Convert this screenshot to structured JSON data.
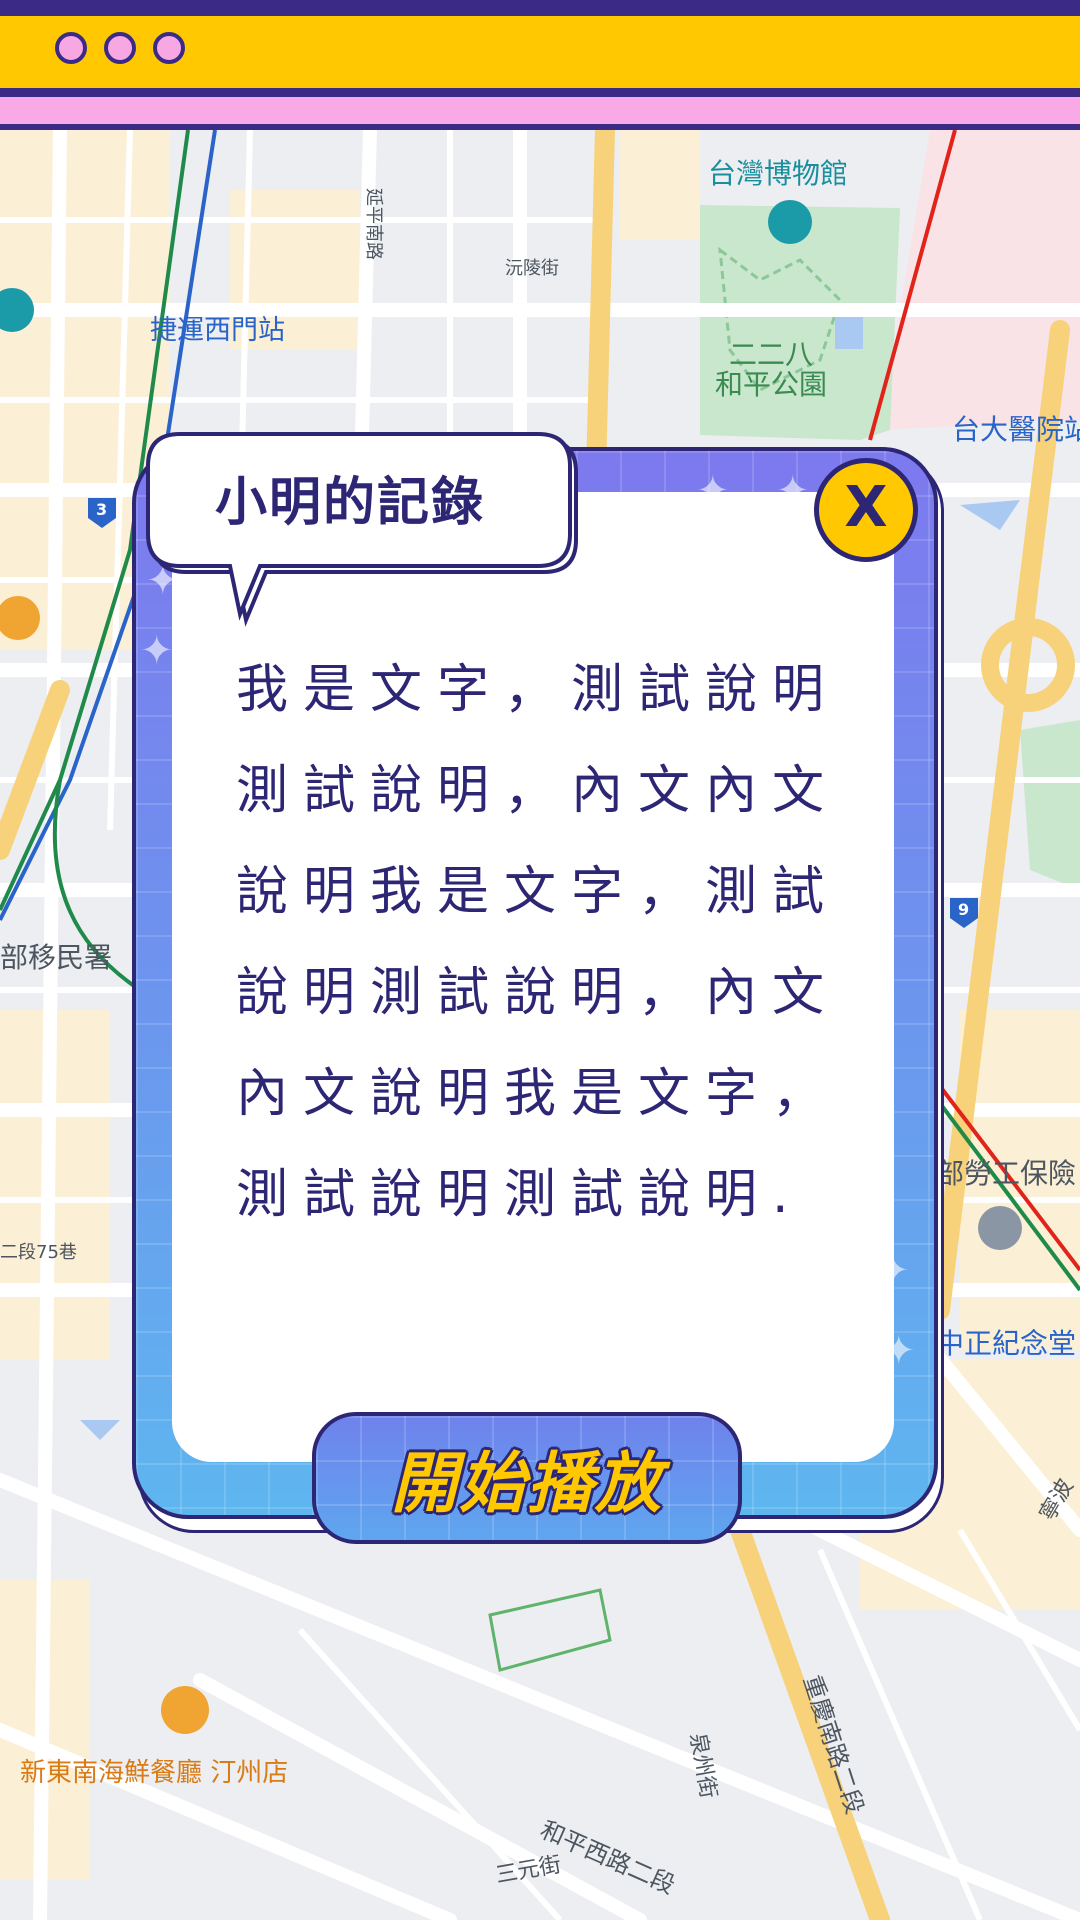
{
  "window": {
    "dots": [
      "dot",
      "dot",
      "dot"
    ]
  },
  "map": {
    "labels": {
      "museum": "台灣博物館",
      "mrt_ximen": "捷運西門站",
      "park": "二二八\n和平公園",
      "ntuh": "台大醫院站",
      "immigration": "部移民署",
      "labor": "部勞工保險",
      "cks": "中正紀念堂",
      "restaurant": "新東南海鮮餐廳 汀州店",
      "heping_rd": "和平西路二段",
      "chongqing_rd": "重慶南路二段",
      "sanyuan": "三元街",
      "quanzhou": "泉州街",
      "yanping": "延平南路",
      "yuanling": "沅陵街",
      "lane75": "二段75巷",
      "ningbo": "寧波",
      "route3": "3",
      "route9": "9"
    }
  },
  "modal": {
    "title": "小明的記錄",
    "close_label": "X",
    "body": "我是文字，測試說明測試說明，內文內文說明我是文字，測試說明測試說明，內文內文說明我是文字，測試說明測試說明.",
    "play_label": "開始播放"
  },
  "colors": {
    "navy": "#2d2675",
    "yellow": "#ffc800",
    "pink": "#f8a9e6",
    "modal_top": "#7d79ee",
    "modal_bottom": "#5eb6ef"
  }
}
